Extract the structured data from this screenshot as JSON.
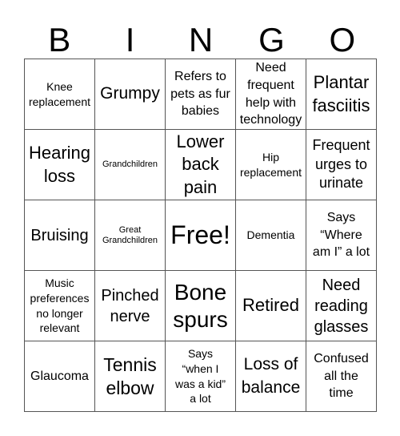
{
  "header": [
    "B",
    "I",
    "N",
    "G",
    "O"
  ],
  "cells": [
    [
      "Knee\nreplacement",
      "Grumpy",
      "Refers to\npets as fur\nbabies",
      "Need\nfrequent\nhelp with\ntechnology",
      "Plantar\nfasciitis"
    ],
    [
      "Hearing\nloss",
      "Grandchildren",
      "Lower\nback\npain",
      "Hip\nreplacement",
      "Frequent\nurges to\nurinate"
    ],
    [
      "Bruising",
      "Great\nGrandchildren",
      "Free!",
      "Dementia",
      "Says\n“Where\nam I” a lot"
    ],
    [
      "Music\npreferences\nno longer\nrelevant",
      "Pinched\nnerve",
      "Bone\nspurs",
      "Retired",
      "Need\nreading\nglasses"
    ],
    [
      "Glaucoma",
      "Tennis\nelbow",
      "Says\n“when I\nwas a kid”\na lot",
      "Loss of\nbalance",
      "Confused\nall the\ntime"
    ]
  ]
}
